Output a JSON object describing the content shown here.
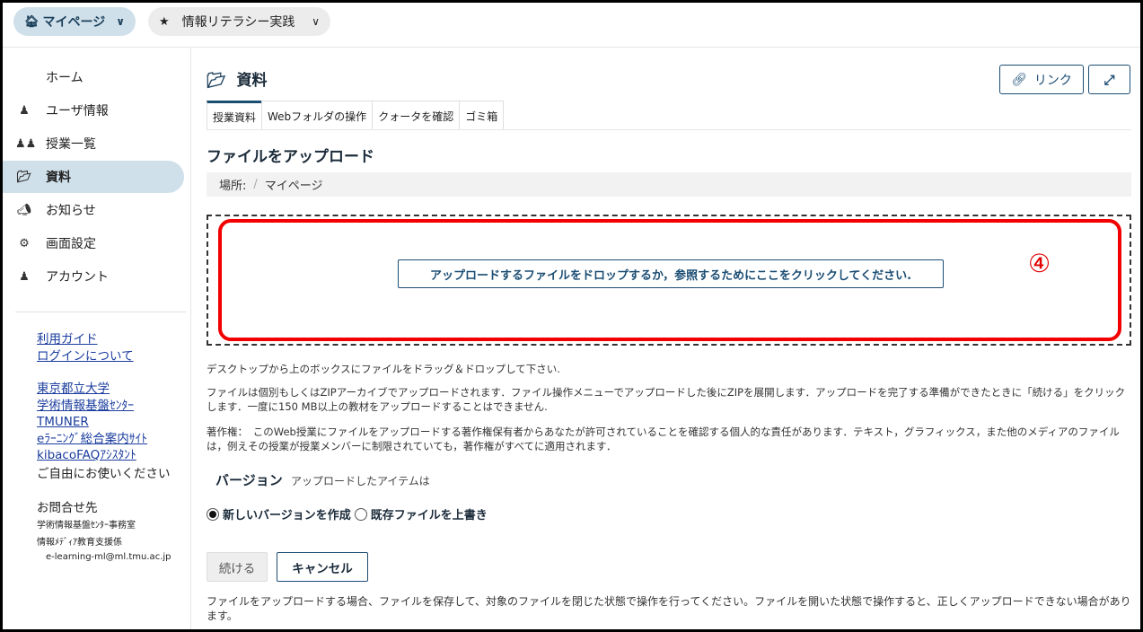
{
  "topbar": {
    "mypage_label": "マイページ",
    "mypage_icon": "home-icon",
    "course_label": "情報リテラシー実践",
    "course_icon": "star-icon",
    "chevron": "chevron-down-icon"
  },
  "sidebar": {
    "items": [
      {
        "label": "ホーム",
        "icon": ""
      },
      {
        "label": "ユーザ情報",
        "icon": "user-icon"
      },
      {
        "label": "授業一覧",
        "icon": "users-icon"
      },
      {
        "label": "資料",
        "icon": "folder-open-icon",
        "active": true
      },
      {
        "label": "お知らせ",
        "icon": "megaphone-icon"
      },
      {
        "label": "画面設定",
        "icon": "gear-icon"
      },
      {
        "label": "アカウント",
        "icon": "user-icon"
      }
    ],
    "links1": [
      "利用ガイド",
      "ログインについて"
    ],
    "links2": [
      "東京都立大学",
      "学術情報基盤ｾﾝﾀｰ",
      "TMUNER",
      "eﾗｰﾆﾝｸﾞ総合案内ｻｲﾄ",
      "kibacoFAQｱｼｽﾀﾝﾄ"
    ],
    "free_use": "ご自由にお使いください",
    "contact_title": "お問合せ先",
    "contact_line1": "学術情報基盤ｾﾝﾀｰ事務室",
    "contact_line2": "情報ﾒﾃﾞｨｱ教育支援係",
    "contact_email": "e-learning-ml@ml.tmu.ac.jp"
  },
  "main": {
    "title": "資料",
    "link_button": "リンク",
    "tabs": [
      "授業資料",
      "Webフォルダの操作",
      "クォータを確認",
      "ゴミ箱"
    ],
    "section_title": "ファイルをアップロード",
    "breadcrumb_label": "場所:",
    "breadcrumb_sep": "/",
    "breadcrumb_current": "マイページ",
    "drop_button": "アップロードするファイルをドロップするか，参照するためにここをクリックしてください.",
    "marker": "④",
    "desc1": "デスクトップから上のボックスにファイルをドラッグ＆ドロップして下さい.",
    "desc2": "ファイルは個別もしくはZIPアーカイブでアップロードされます．ファイル操作メニューでアップロードした後にZIPを展開します．アップロードを完了する準備ができたときに「続ける」をクリックします．一度に150 MB以上の教材をアップロードすることはできません.",
    "desc3": "著作権：　このWeb授業にファイルをアップロードする著作権保有者からあなたが許可されていることを確認する個人的な責任があります．テキスト，グラフィックス，また他のメディアのファイルは，例えその授業が授業メンバーに制限されていても，著作権がすべてに適用されます．",
    "version_title": "バージョン",
    "version_sub": "アップロードしたアイテムは",
    "radio_new": "新しいバージョンを作成",
    "radio_overwrite": "既存ファイルを上書き",
    "continue_button": "続ける",
    "cancel_button": "キャンセル",
    "footer_note": "ファイルをアップロードする場合、ファイルを保存して、対象のファイルを閉じた状態で操作を行ってください。ファイルを開いた状態で操作すると、正しくアップロードできない場合があります。"
  },
  "colors": {
    "accent": "#1b4d73",
    "active_bg": "#cfe0ea",
    "highlight_red": "#f20000"
  }
}
